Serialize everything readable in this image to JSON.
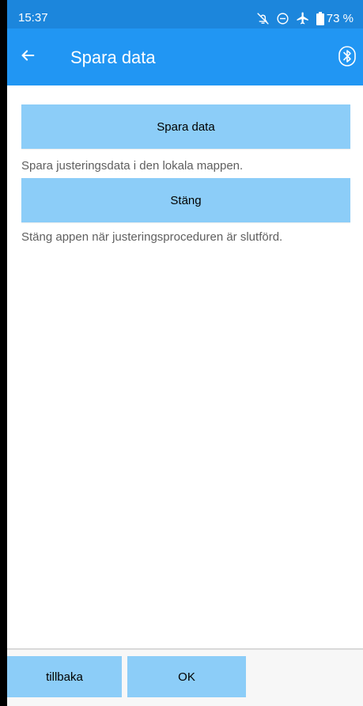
{
  "status_bar": {
    "time": "15:37",
    "icons": [
      "alarm-off-icon",
      "do-not-disturb-icon",
      "airplane-icon",
      "battery-icon"
    ],
    "battery_percent": "73 %"
  },
  "app_bar": {
    "back_icon": "arrow-left-icon",
    "title": "Spara data",
    "bluetooth_icon": "bluetooth-icon"
  },
  "actions": {
    "save_label": "Spara data",
    "save_description": "Spara justeringsdata i den lokala mappen.",
    "close_label": "Stäng",
    "close_description": "Stäng appen när justeringsproceduren är slutförd."
  },
  "bottom_nav": {
    "back_label": "tillbaka",
    "ok_label": "OK"
  },
  "colors": {
    "status_bar": "#1c86dc",
    "app_bar": "#2196f3",
    "button": "#8ccdf8",
    "description_text": "#5f5f5f"
  }
}
